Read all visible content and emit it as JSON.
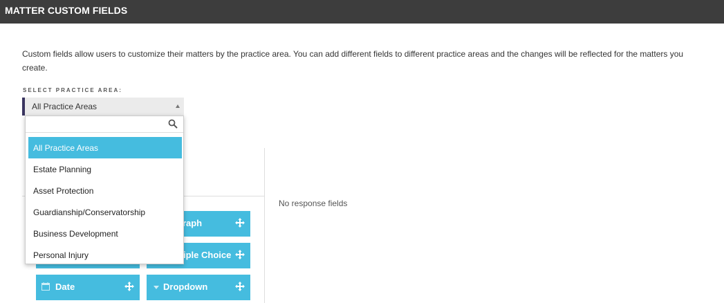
{
  "header": {
    "title": "MATTER CUSTOM FIELDS"
  },
  "description": "Custom fields allow users to customize their matters by the practice area. You can add different fields to different practice areas and the changes will be reflected for the matters you create.",
  "practice_area": {
    "label": "SELECT PRACTICE AREA:",
    "selected": "All Practice Areas",
    "search_placeholder": "",
    "options": [
      "All Practice Areas",
      "Estate Planning",
      "Asset Protection",
      "Guardianship/Conservatorship",
      "Business Development",
      "Personal Injury"
    ]
  },
  "field_types": {
    "paragraph_partial": "graph",
    "multiple_choice_partial": "iple Choice",
    "date": "Date",
    "dropdown": "Dropdown"
  },
  "response_panel": {
    "empty_text": "No response fields"
  },
  "colors": {
    "accent": "#45bcdf",
    "header_bg": "#3d3d3d",
    "select_border": "#3a3560"
  }
}
